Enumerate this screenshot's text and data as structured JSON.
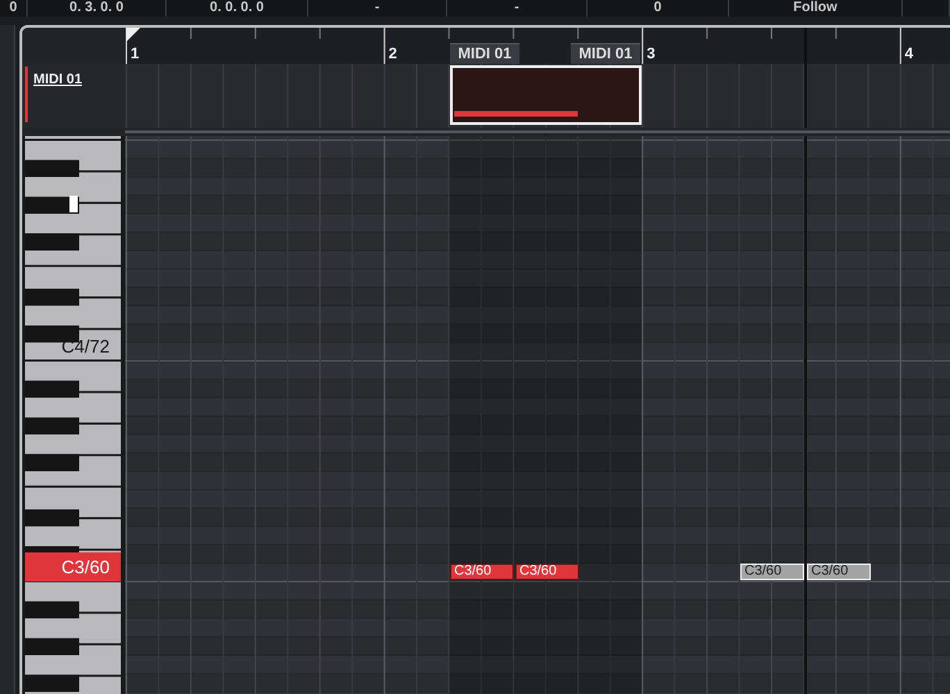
{
  "toolbar": {
    "fields": [
      "0",
      "0. 3. 0. 0",
      "0. 0. 0. 0",
      "-",
      "-",
      "0",
      "Follow"
    ]
  },
  "ruler": {
    "bars": [
      "1",
      "2",
      "3",
      "4"
    ]
  },
  "part_labels": [
    "MIDI 01",
    "MIDI 01"
  ],
  "track": {
    "name": "MIDI 01"
  },
  "keyboard": {
    "labels": [
      {
        "text": "C4/72",
        "highlighted": false
      },
      {
        "text": "C3/60",
        "highlighted": true
      }
    ]
  },
  "notes": [
    {
      "label": "C3/60",
      "selected": true
    },
    {
      "label": "C3/60",
      "selected": true
    },
    {
      "label": "C3/60",
      "selected": false
    },
    {
      "label": "C3/60",
      "selected": false
    }
  ]
}
